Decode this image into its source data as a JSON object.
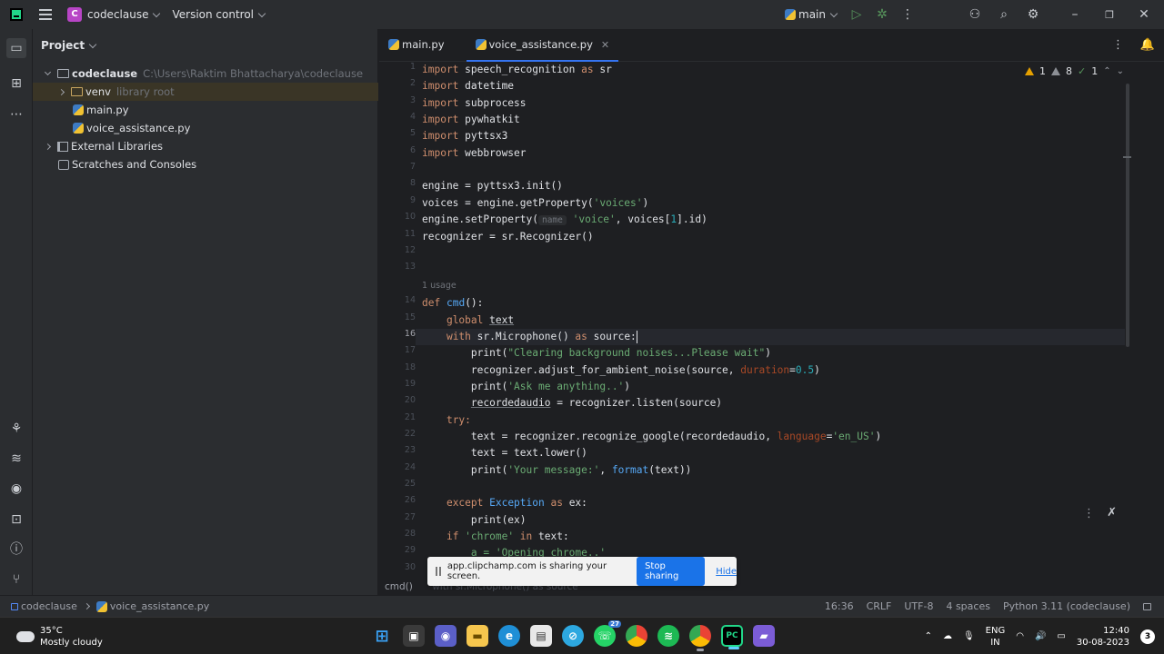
{
  "titlebar": {
    "project_badge": "C",
    "project_name": "codeclause",
    "version_control": "Version control",
    "branch": "main"
  },
  "project_panel": {
    "title": "Project",
    "root_name": "codeclause",
    "root_path": "C:\\Users\\Raktim Bhattacharya\\codeclause",
    "venv_name": "venv",
    "venv_note": "library root",
    "file1": "main.py",
    "file2": "voice_assistance.py",
    "external": "External Libraries",
    "scratches": "Scratches and Consoles"
  },
  "editor": {
    "tabs": [
      {
        "label": "main.py"
      },
      {
        "label": "voice_assistance.py"
      }
    ],
    "inspections": {
      "warnings": "1",
      "weak": "8",
      "typos": "1"
    },
    "usage_hint": "1 usage",
    "param_hint": "name",
    "line_numbers": [
      "1",
      "2",
      "3",
      "4",
      "5",
      "6",
      "7",
      "8",
      "9",
      "10",
      "11",
      "12",
      "13",
      "14",
      "15",
      "16",
      "17",
      "18",
      "19",
      "20",
      "21",
      "22",
      "23",
      "24",
      "25",
      "26",
      "27",
      "28",
      "29",
      "30"
    ],
    "breadcrumb_fn": "cmd()",
    "breadcrumb_ctx": "with sr.Microphone() as source"
  },
  "code": {
    "l1": [
      "import",
      " speech_recognition ",
      "as",
      " sr"
    ],
    "l2": [
      "import",
      " datetime"
    ],
    "l3": [
      "import",
      " subprocess"
    ],
    "l4": [
      "import",
      " pywhatkit"
    ],
    "l5": [
      "import",
      " pyttsx3"
    ],
    "l6": [
      "import",
      " webbrowser"
    ],
    "l8": "engine = pyttsx3.init()",
    "l9a": "voices = engine.getProperty(",
    "l9b": "'voices'",
    "l9c": ")",
    "l10a": "engine.setProperty(",
    "l10b": "'voice'",
    "l10c": ", voices[",
    "l10d": "1",
    "l10e": "].id)",
    "l11": "recognizer = sr.Recognizer()",
    "l14a": "def",
    "l14b": "cmd",
    "l14c": "():",
    "l15a": "global",
    "l15b": "text",
    "l16a": "with",
    "l16b": " sr.Microphone() ",
    "l16c": "as",
    "l16d": " source:",
    "l17a": "print(",
    "l17b": "\"Clearing background noises...Please wait\"",
    "l17c": ")",
    "l18a": "recognizer.adjust_for_ambient_noise(source, ",
    "l18b": "duration",
    "l18c": "=",
    "l18d": "0.5",
    "l18e": ")",
    "l19a": "print(",
    "l19b": "'Ask me anything..'",
    "l19c": ")",
    "l20a": "recordedaudio",
    "l20b": " = recognizer.listen(source)",
    "l21": "try:",
    "l22a": "text = recognizer.recognize_google(recordedaudio, ",
    "l22b": "language",
    "l22c": "=",
    "l22d": "'en_US'",
    "l22e": ")",
    "l23": "text = text.lower()",
    "l24a": "print(",
    "l24b": "'Your message:'",
    "l24c": ", ",
    "l24d": "format",
    "l24e": "(text))",
    "l26a": "except",
    "l26b": " Exception ",
    "l26c": "as",
    "l26d": " ex:",
    "l27": "print(ex)",
    "l28a": "if",
    "l28b": " 'chrome' ",
    "l28c": "in",
    "l28d": " text:",
    "l29": "a = 'Opening chrome..'"
  },
  "share_banner": {
    "message": "app.clipchamp.com is sharing your screen.",
    "stop": "Stop sharing",
    "hide": "Hide"
  },
  "statusbar": {
    "project": "codeclause",
    "file": "voice_assistance.py",
    "position": "16:36",
    "line_sep": "CRLF",
    "encoding": "UTF-8",
    "indent": "4 spaces",
    "interpreter": "Python 3.11 (codeclause)"
  },
  "taskbar": {
    "temp": "35°C",
    "weather": "Mostly cloudy",
    "lang1": "ENG",
    "lang2": "IN",
    "time": "12:40",
    "date": "30-08-2023",
    "notifications": "3",
    "whatsapp_badge": "27"
  }
}
